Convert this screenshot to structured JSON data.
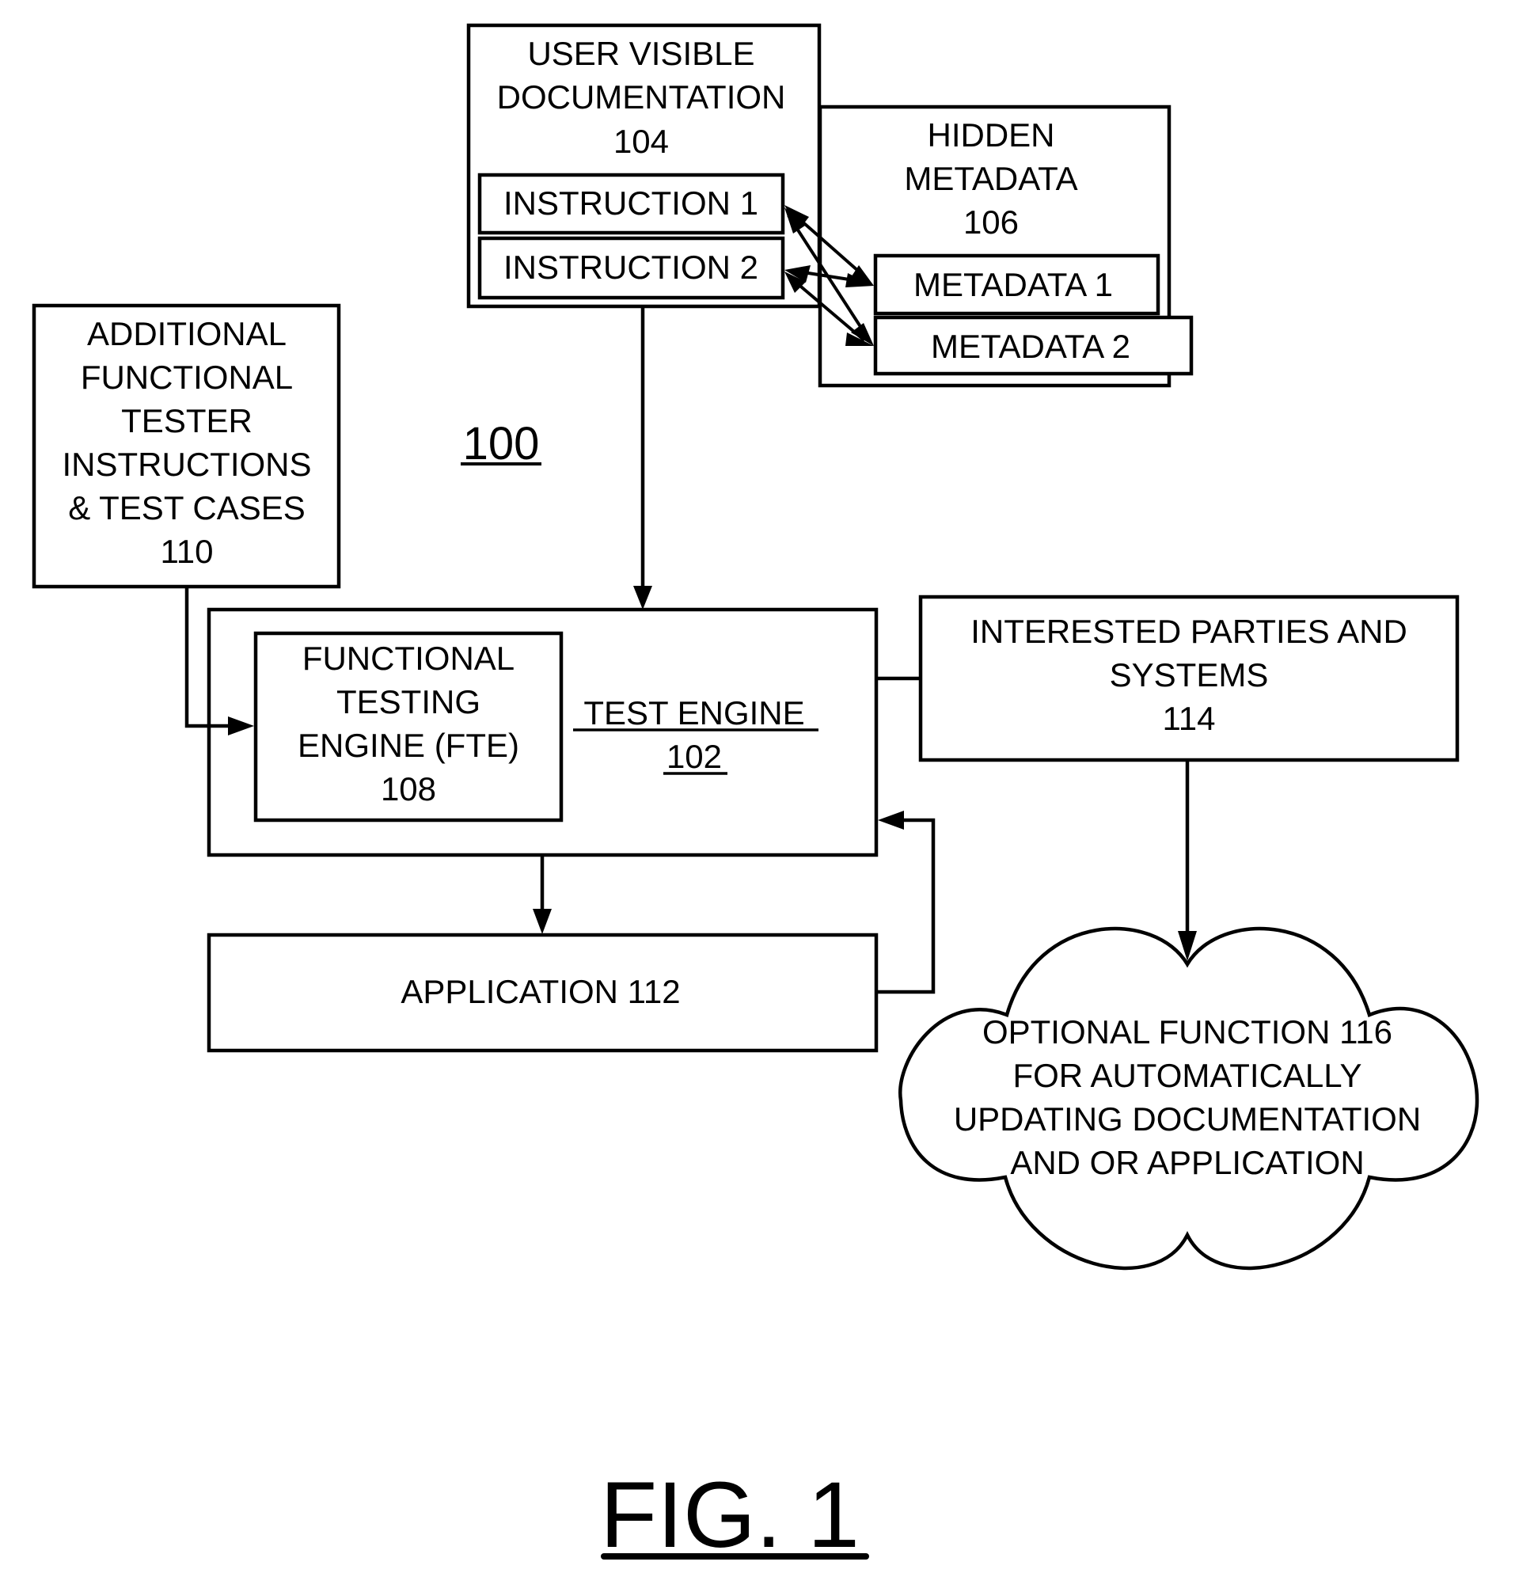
{
  "diagram": {
    "reference_number": "100",
    "figure_label": "FIG. 1",
    "user_visible_documentation": {
      "lines": [
        "USER VISIBLE",
        "DOCUMENTATION",
        "104"
      ],
      "instructions": [
        "INSTRUCTION 1",
        "INSTRUCTION 2"
      ]
    },
    "hidden_metadata": {
      "lines": [
        "HIDDEN",
        "METADATA",
        "106"
      ],
      "items": [
        "METADATA 1",
        "METADATA 2"
      ]
    },
    "additional_tester_instructions": {
      "lines": [
        "ADDITIONAL",
        "FUNCTIONAL",
        "TESTER",
        "INSTRUCTIONS",
        "& TEST CASES",
        "110"
      ]
    },
    "test_engine": {
      "title": "TEST ENGINE",
      "number": "102"
    },
    "functional_testing_engine": {
      "lines": [
        "FUNCTIONAL",
        "TESTING",
        "ENGINE (FTE)",
        "108"
      ]
    },
    "interested_parties": {
      "lines": [
        "INTERESTED PARTIES AND",
        "SYSTEMS",
        "114"
      ]
    },
    "application": {
      "label": "APPLICATION 112"
    },
    "optional_function": {
      "lines": [
        "OPTIONAL FUNCTION 116",
        "FOR AUTOMATICALLY",
        "UPDATING DOCUMENTATION",
        "AND OR APPLICATION"
      ]
    },
    "connections": [
      {
        "from": "USER VISIBLE DOCUMENTATION 104",
        "to": "TEST ENGINE 102",
        "type": "arrow"
      },
      {
        "from": "ADDITIONAL FUNCTIONAL TESTER INSTRUCTIONS & TEST CASES 110",
        "to": "FUNCTIONAL TESTING ENGINE 108",
        "type": "arrow"
      },
      {
        "from": "TEST ENGINE 102",
        "to": "APPLICATION 112",
        "type": "arrow"
      },
      {
        "from": "APPLICATION 112",
        "to": "TEST ENGINE 102",
        "type": "arrow"
      },
      {
        "from": "TEST ENGINE 102",
        "to": "INTERESTED PARTIES AND SYSTEMS 114",
        "type": "line"
      },
      {
        "from": "INTERESTED PARTIES AND SYSTEMS 114",
        "to": "OPTIONAL FUNCTION 116",
        "type": "arrow"
      },
      {
        "from": "INSTRUCTION 1",
        "to": "METADATA 1",
        "type": "bidirectional"
      },
      {
        "from": "INSTRUCTION 1",
        "to": "METADATA 2",
        "type": "bidirectional"
      },
      {
        "from": "INSTRUCTION 2",
        "to": "METADATA 1",
        "type": "bidirectional"
      },
      {
        "from": "INSTRUCTION 2",
        "to": "METADATA 2",
        "type": "bidirectional"
      }
    ]
  }
}
